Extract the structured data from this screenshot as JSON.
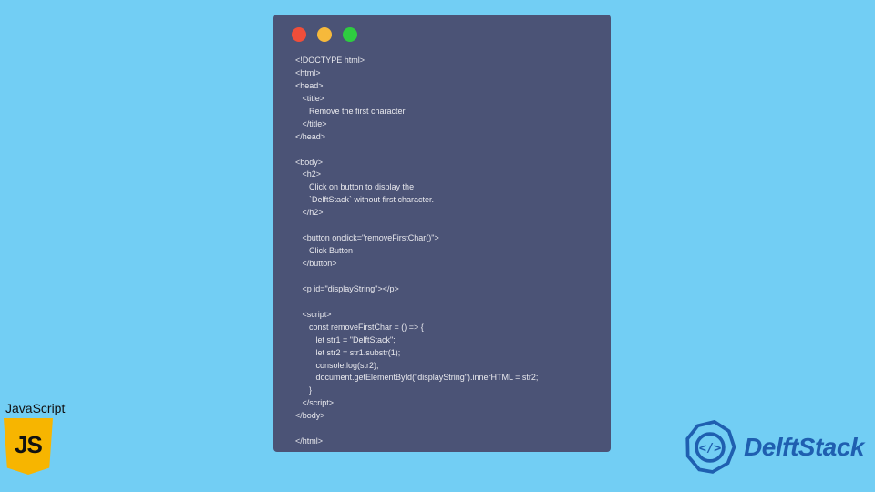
{
  "code_lines": [
    "<!DOCTYPE html>",
    "<html>",
    "<head>",
    "   <title>",
    "      Remove the first character",
    "   </title>",
    "</head>",
    "",
    "<body>",
    "   <h2>",
    "      Click on button to display the",
    "      `DelftStack` without first character.",
    "   </h2>",
    "",
    "   <button onclick=\"removeFirstChar()\">",
    "      Click Button",
    "   </button>",
    "",
    "   <p id=\"displayString\"></p>",
    "",
    "   <script>",
    "      const removeFirstChar = () => {",
    "         let str1 = \"DelftStack\";",
    "         let str2 = str1.substr(1);",
    "         console.log(str2);",
    "         document.getElementById(\"displayString\").innerHTML = str2;",
    "      }",
    "   </script>",
    "</body>",
    "",
    "</html>"
  ],
  "badge": {
    "label": "JavaScript",
    "logo_text": "JS"
  },
  "brand": {
    "name": "DelftStack"
  },
  "colors": {
    "background": "#72cef4",
    "code_bg": "#4b5376",
    "dot_red": "#ef4e3a",
    "dot_yellow": "#f6b93b",
    "dot_green": "#2ecc40",
    "js_logo": "#f7b500",
    "brand_text": "#1f5fb0"
  }
}
